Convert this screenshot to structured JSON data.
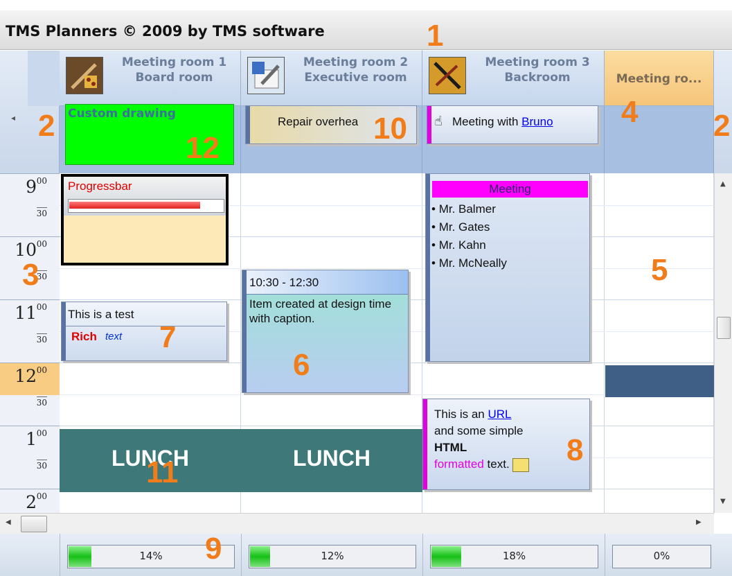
{
  "app": {
    "title": "TMS Planners © 2009 by TMS software"
  },
  "resources": [
    {
      "line1": "Meeting room 1",
      "line2": "Board room",
      "icon": "tools-icon"
    },
    {
      "line1": "Meeting room 2",
      "line2": "Executive room",
      "icon": "wrench-folder-icon"
    },
    {
      "line1": "Meeting room 3",
      "line2": "Backroom",
      "icon": "screwdriver-icon"
    },
    {
      "line1": "Meeting ro...",
      "line2": ""
    }
  ],
  "ruler": [
    {
      "hour": "9",
      "min": "00",
      "half": "30"
    },
    {
      "hour": "10",
      "min": "00",
      "half": "30"
    },
    {
      "hour": "11",
      "min": "00",
      "half": "30"
    },
    {
      "hour": "12",
      "min": "00",
      "half": "30"
    },
    {
      "hour": "1",
      "min": "00",
      "half": "30"
    },
    {
      "hour": "2",
      "min": "00",
      "half": ""
    }
  ],
  "allday": {
    "custom_drawing": "Custom drawing",
    "repair": "Repair overhea",
    "meeting_with": "Meeting with",
    "meeting_link": "Bruno"
  },
  "items": {
    "progressbar": {
      "title": "Progressbar",
      "progress": 0.85
    },
    "rich": {
      "line1": "This is a test",
      "rich": "Rich",
      "text": "text"
    },
    "design": {
      "time": "10:30 - 12:30",
      "caption": "Item created at design time with caption."
    },
    "meeting": {
      "title": "Meeting",
      "attendees": [
        "Mr. Balmer",
        "Mr. Gates",
        "Mr. Kahn",
        "Mr. McNeally"
      ]
    },
    "html": {
      "pre": "This is an",
      "link": "URL",
      "line2": "and some simple",
      "bold": "HTML",
      "colored": "formatted",
      "post": "text."
    },
    "lunch": "LUNCH"
  },
  "callouts": [
    "1",
    "2",
    "2",
    "3",
    "4",
    "5",
    "6",
    "7",
    "8",
    "9",
    "10",
    "11",
    "12"
  ],
  "footer": [
    {
      "label": "14%",
      "value": 0.14
    },
    {
      "label": "12%",
      "value": 0.12
    },
    {
      "label": "18%",
      "value": 0.18
    },
    {
      "label": "0%",
      "value": 0
    }
  ],
  "colors": {
    "accent": "#f07d1a",
    "custom": "#00ff00",
    "meeting_header": "#ff00ff",
    "lunch": "#3f7878"
  }
}
